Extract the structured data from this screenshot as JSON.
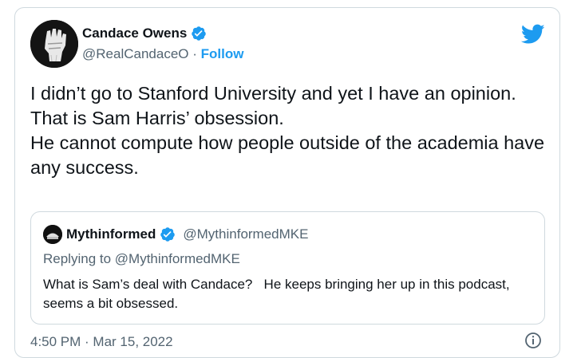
{
  "author": {
    "name": "Candace Owens",
    "handle": "@RealCandaceO",
    "separator": "·",
    "follow_label": "Follow"
  },
  "tweet": {
    "text": "I didn’t go to Stanford University and yet I have an opinion.\nThat is Sam Harris’ obsession.\nHe cannot compute how people outside of the academia have any success."
  },
  "quoted": {
    "name": "Mythinformed",
    "handle": "@MythinformedMKE",
    "replying_to": "Replying to @MythinformedMKE",
    "text": "What is Sam’s deal with Candace?   He keeps bringing her up in this podcast, seems a bit obsessed."
  },
  "footer": {
    "timestamp": "4:50 PM · Mar 15, 2022"
  },
  "colors": {
    "accent": "#1d9bf0",
    "text": "#0f1419",
    "secondary": "#536471",
    "border": "#cfd9de"
  },
  "icons": {
    "verified": "verified-badge-icon",
    "brand": "twitter-bird-icon",
    "info": "info-icon"
  }
}
